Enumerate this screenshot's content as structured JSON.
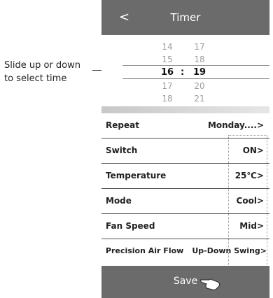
{
  "annotation": {
    "line1": "Slide up or down",
    "line2": "to select time"
  },
  "header": {
    "back_label": "<",
    "title": "Timer"
  },
  "picker": {
    "rows": [
      {
        "hour": "14",
        "minute": "17"
      },
      {
        "hour": "15",
        "minute": "18"
      },
      {
        "hour": "16",
        "minute": "19"
      },
      {
        "hour": "17",
        "minute": "20"
      },
      {
        "hour": "18",
        "minute": "21"
      }
    ],
    "separator": ":"
  },
  "settings": [
    {
      "label": "Repeat",
      "value": "Monday....>"
    },
    {
      "label": "Switch",
      "value": "ON>"
    },
    {
      "label": "Temperature",
      "value": "25℃>"
    },
    {
      "label": "Mode",
      "value": "Cool>"
    },
    {
      "label": "Fan Speed",
      "value": "Mid>"
    },
    {
      "label": "Precision Air Flow",
      "value": "Up-Down Swing>"
    }
  ],
  "save_label": "Save",
  "icons": {
    "hand": "hand-pointer-icon"
  }
}
